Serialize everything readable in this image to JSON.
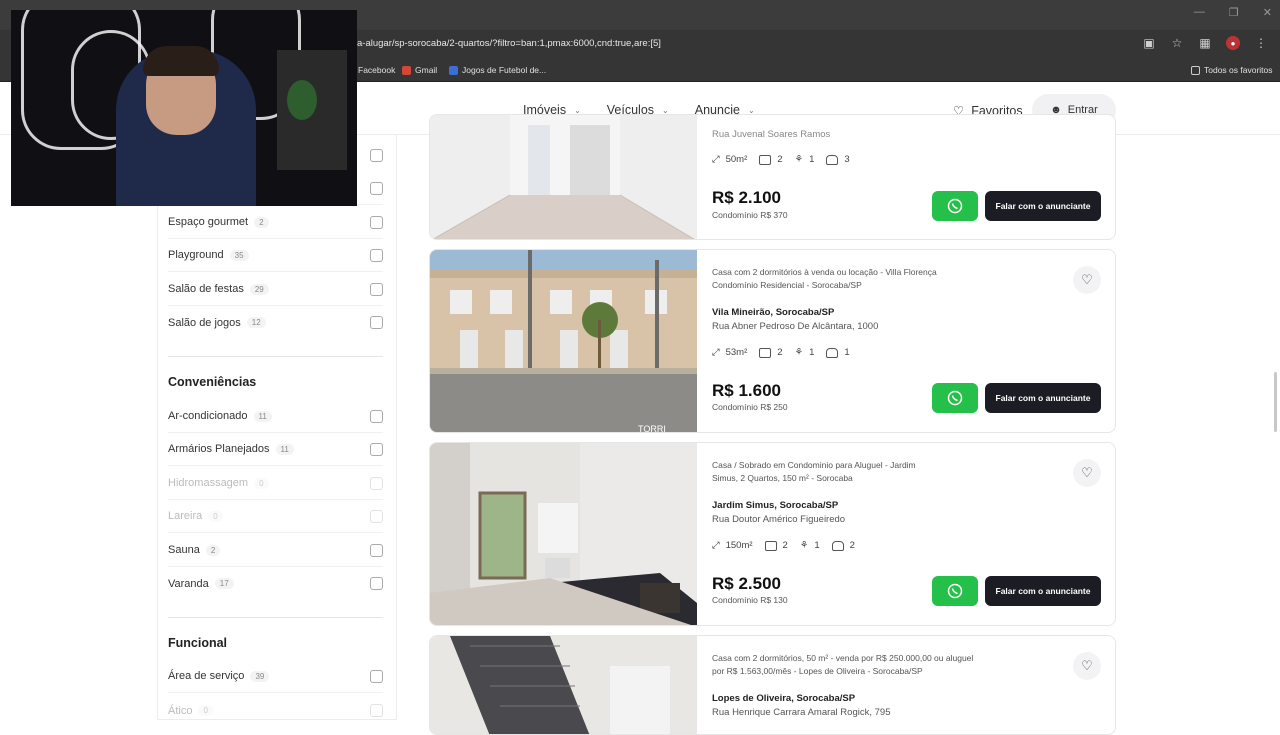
{
  "browser": {
    "url": "a-alugar/sp-sorocaba/2-quartos/?filtro=ban:1,pmax:6000,cnd:true,are:[5]",
    "bookmarks": [
      "Facebook",
      "Gmail",
      "Jogos de Futebol de..."
    ],
    "all_bookmarks": "Todos os favoritos"
  },
  "header": {
    "nav": [
      "Imóveis",
      "Veículos",
      "Anuncie"
    ],
    "favorites": "Favoritos",
    "login": "Entrar"
  },
  "sidebar": {
    "top_items": [
      {
        "label": "Espaço gourmet",
        "count": "2"
      },
      {
        "label": "Playground",
        "count": "35"
      },
      {
        "label": "Salão de festas",
        "count": "29"
      },
      {
        "label": "Salão de jogos",
        "count": "12"
      }
    ],
    "conveniences_title": "Conveniências",
    "conveniences": [
      {
        "label": "Ar-condicionado",
        "count": "11"
      },
      {
        "label": "Armários Planejados",
        "count": "11"
      },
      {
        "label": "Hidromassagem",
        "count": "0"
      },
      {
        "label": "Lareira",
        "count": "0"
      },
      {
        "label": "Sauna",
        "count": "2"
      },
      {
        "label": "Varanda",
        "count": "17"
      }
    ],
    "functional_title": "Funcional",
    "functional": [
      {
        "label": "Área de serviço",
        "count": "39"
      },
      {
        "label": "Ático",
        "count": "0"
      }
    ]
  },
  "listings": [
    {
      "description": "",
      "location": "",
      "address": "Rua Juvenal Soares Ramos",
      "area": "50m²",
      "bedrooms": "2",
      "bathrooms": "1",
      "parking": "3",
      "price": "R$ 2.100",
      "condo": "Condomínio R$ 370"
    },
    {
      "description": "Casa com 2 dormitórios à venda ou locação - Villa Florença Condomínio Residencial - Sorocaba/SP",
      "location": "Vila Mineirão, Sorocaba/SP",
      "address": "Rua Abner Pedroso De Alcântara, 1000",
      "area": "53m²",
      "bedrooms": "2",
      "bathrooms": "1",
      "parking": "1",
      "price": "R$ 1.600",
      "condo": "Condomínio R$ 250",
      "watermark": "TORRI"
    },
    {
      "description": "Casa / Sobrado em Condominio para Aluguel - Jardim Simus, 2 Quartos, 150 m² - Sorocaba",
      "location": "Jardim Simus, Sorocaba/SP",
      "address": "Rua Doutor Américo Figueiredo",
      "area": "150m²",
      "bedrooms": "2",
      "bathrooms": "1",
      "parking": "2",
      "price": "R$ 2.500",
      "condo": "Condomínio R$ 130"
    },
    {
      "description": "Casa com 2 dormitórios, 50 m² - venda por R$ 250.000,00 ou aluguel por R$ 1.563,00/mês - Lopes de Oliveira - Sorocaba/SP",
      "location": "Lopes de Oliveira, Sorocaba/SP",
      "address": "Rua Henrique Carrara Amaral Rogick, 795"
    }
  ],
  "call_button_label": "Falar com o anunciante",
  "colors": {
    "whatsapp": "#25c04a",
    "call_button": "#1c1c24"
  }
}
